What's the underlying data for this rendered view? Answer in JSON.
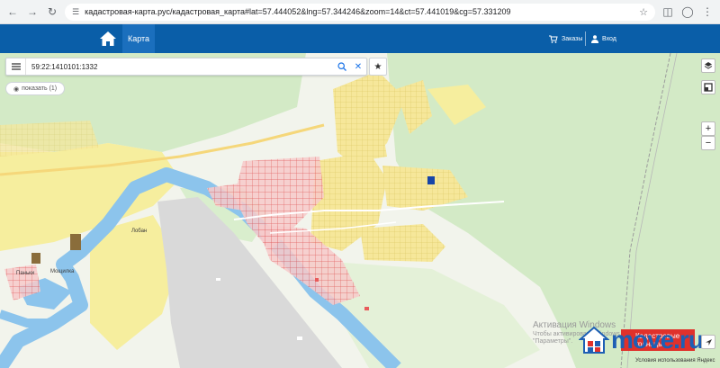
{
  "browser": {
    "url": "кадастровая-карта.рус/кадастровая_карта#lat=57.444052&lng=57.344246&zoom=14&ct=57.441019&cg=57.331209"
  },
  "header": {
    "map_tab": "Карта",
    "orders": "Заказы",
    "login": "Вход"
  },
  "search": {
    "value": "59:22:1410101:1332"
  },
  "show_button": "показать (1)",
  "map_labels": {
    "lobvan": "Лобан",
    "pashkovo": "Паньки",
    "moshchilka": "Мощилка"
  },
  "watermark": {
    "title": "Активация Windows",
    "line2": "Чтобы активировать Windows, перейдите в раздел",
    "line3": "\"Параметры\"."
  },
  "borders_button": "Кадастровые границы",
  "logo": "move.ru",
  "attribution": "Условия использования  Яндекс",
  "colors": {
    "header": "#0a5ea8",
    "river": "#7fb8e6",
    "forest": "#cfe8c0",
    "parcel_yellow": "#f5e58a",
    "parcel_red": "#e85b5b",
    "selected": "#1745a8"
  }
}
